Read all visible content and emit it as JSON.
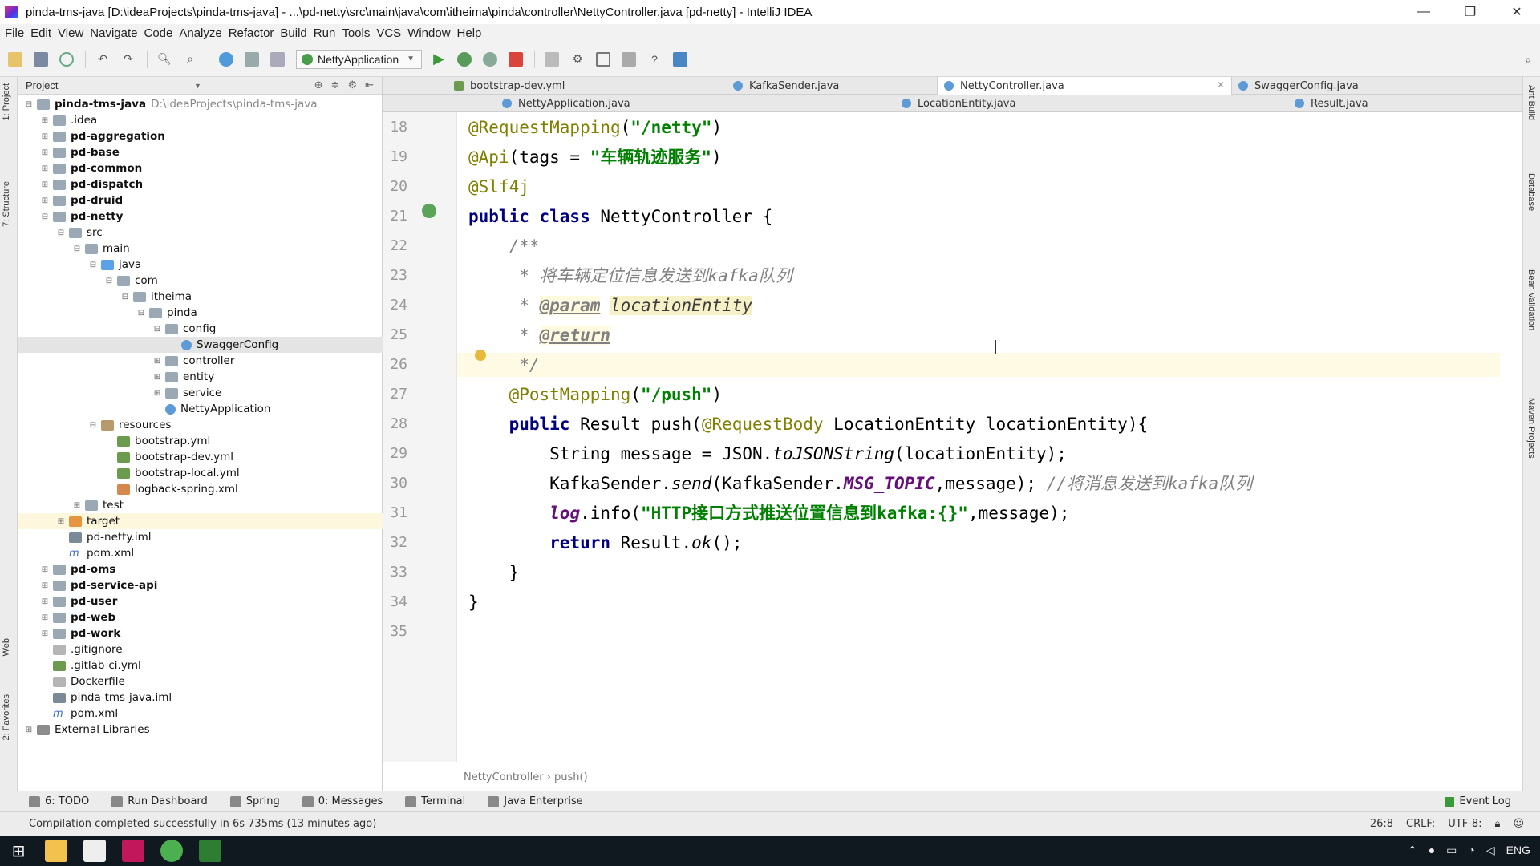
{
  "window": {
    "title": "pinda-tms-java [D:\\ideaProjects\\pinda-tms-java] - ...\\pd-netty\\src\\main\\java\\com\\itheima\\pinda\\controller\\NettyController.java [pd-netty] - IntelliJ IDEA",
    "minimize": "—",
    "restore": "❐",
    "close": "✕"
  },
  "menu": [
    "File",
    "Edit",
    "View",
    "Navigate",
    "Code",
    "Analyze",
    "Refactor",
    "Build",
    "Run",
    "Tools",
    "VCS",
    "Window",
    "Help"
  ],
  "toolbar": {
    "run_config": "NettyApplication",
    "icons": [
      "open-icon",
      "save-icon",
      "sync-icon",
      "undo-icon",
      "redo-icon",
      "find-icon",
      "replace-icon",
      "back-icon",
      "forward-icon",
      "run-icon",
      "debug-icon",
      "coverage-icon",
      "stop-icon",
      "build-icon",
      "settings-icon",
      "structure-icon",
      "help-icon",
      "search-icon"
    ]
  },
  "project_panel": {
    "header": "Project",
    "tree": [
      {
        "label": "pinda-tms-java",
        "extra": "D:\\ideaProjects\\pinda-tms-java",
        "depth": 0,
        "toggle": "⊟",
        "icon": "module",
        "bold": true
      },
      {
        "label": ".idea",
        "depth": 1,
        "toggle": "⊞",
        "icon": "folder"
      },
      {
        "label": "pd-aggregation",
        "depth": 1,
        "toggle": "⊞",
        "icon": "module",
        "bold": true
      },
      {
        "label": "pd-base",
        "depth": 1,
        "toggle": "⊞",
        "icon": "module",
        "bold": true
      },
      {
        "label": "pd-common",
        "depth": 1,
        "toggle": "⊞",
        "icon": "module",
        "bold": true
      },
      {
        "label": "pd-dispatch",
        "depth": 1,
        "toggle": "⊞",
        "icon": "module",
        "bold": true
      },
      {
        "label": "pd-druid",
        "depth": 1,
        "toggle": "⊞",
        "icon": "module",
        "bold": true
      },
      {
        "label": "pd-netty",
        "depth": 1,
        "toggle": "⊟",
        "icon": "module",
        "bold": true
      },
      {
        "label": "src",
        "depth": 2,
        "toggle": "⊟",
        "icon": "folder"
      },
      {
        "label": "main",
        "depth": 3,
        "toggle": "⊟",
        "icon": "folder"
      },
      {
        "label": "java",
        "depth": 4,
        "toggle": "⊟",
        "icon": "src"
      },
      {
        "label": "com",
        "depth": 5,
        "toggle": "⊟",
        "icon": "folder"
      },
      {
        "label": "itheima",
        "depth": 6,
        "toggle": "⊟",
        "icon": "folder"
      },
      {
        "label": "pinda",
        "depth": 7,
        "toggle": "⊟",
        "icon": "folder"
      },
      {
        "label": "config",
        "depth": 8,
        "toggle": "⊟",
        "icon": "folder"
      },
      {
        "label": "SwaggerConfig",
        "depth": 9,
        "toggle": "",
        "icon": "class",
        "selected": true
      },
      {
        "label": "controller",
        "depth": 8,
        "toggle": "⊞",
        "icon": "folder"
      },
      {
        "label": "entity",
        "depth": 8,
        "toggle": "⊞",
        "icon": "folder"
      },
      {
        "label": "service",
        "depth": 8,
        "toggle": "⊞",
        "icon": "folder"
      },
      {
        "label": "NettyApplication",
        "depth": 8,
        "toggle": "",
        "icon": "class"
      },
      {
        "label": "resources",
        "depth": 4,
        "toggle": "⊟",
        "icon": "res"
      },
      {
        "label": "bootstrap.yml",
        "depth": 5,
        "toggle": "",
        "icon": "yml"
      },
      {
        "label": "bootstrap-dev.yml",
        "depth": 5,
        "toggle": "",
        "icon": "yml"
      },
      {
        "label": "bootstrap-local.yml",
        "depth": 5,
        "toggle": "",
        "icon": "yml"
      },
      {
        "label": "logback-spring.xml",
        "depth": 5,
        "toggle": "",
        "icon": "xml"
      },
      {
        "label": "test",
        "depth": 3,
        "toggle": "⊞",
        "icon": "folder"
      },
      {
        "label": "target",
        "depth": 2,
        "toggle": "⊞",
        "icon": "target",
        "target": true
      },
      {
        "label": "pd-netty.iml",
        "depth": 2,
        "toggle": "",
        "icon": "iml"
      },
      {
        "label": "pom.xml",
        "depth": 2,
        "toggle": "",
        "icon": "pom"
      },
      {
        "label": "pd-oms",
        "depth": 1,
        "toggle": "⊞",
        "icon": "module",
        "bold": true
      },
      {
        "label": "pd-service-api",
        "depth": 1,
        "toggle": "⊞",
        "icon": "module",
        "bold": true
      },
      {
        "label": "pd-user",
        "depth": 1,
        "toggle": "⊞",
        "icon": "module",
        "bold": true
      },
      {
        "label": "pd-web",
        "depth": 1,
        "toggle": "⊞",
        "icon": "module",
        "bold": true
      },
      {
        "label": "pd-work",
        "depth": 1,
        "toggle": "⊞",
        "icon": "module",
        "bold": true
      },
      {
        "label": ".gitignore",
        "depth": 1,
        "toggle": "",
        "icon": "file"
      },
      {
        "label": ".gitlab-ci.yml",
        "depth": 1,
        "toggle": "",
        "icon": "yml"
      },
      {
        "label": "Dockerfile",
        "depth": 1,
        "toggle": "",
        "icon": "file"
      },
      {
        "label": "pinda-tms-java.iml",
        "depth": 1,
        "toggle": "",
        "icon": "iml"
      },
      {
        "label": "pom.xml",
        "depth": 1,
        "toggle": "",
        "icon": "pom"
      },
      {
        "label": "External Libraries",
        "depth": 0,
        "toggle": "⊞",
        "icon": "lib"
      }
    ]
  },
  "tabs_row1": [
    {
      "label": "bootstrap-dev.yml",
      "icon": "yml"
    },
    {
      "label": "KafkaSender.java",
      "icon": "class"
    },
    {
      "label": "NettyController.java",
      "icon": "class",
      "active": true,
      "close": "✕"
    },
    {
      "label": "SwaggerConfig.java",
      "icon": "class"
    }
  ],
  "tabs_row2": [
    {
      "label": "NettyApplication.java",
      "icon": "class"
    },
    {
      "label": "LocationEntity.java",
      "icon": "class"
    },
    {
      "label": "Result.java",
      "icon": "class"
    }
  ],
  "editor": {
    "lines": [
      {
        "no": "18",
        "html": "<span class=\"ann\">@RequestMapping</span>(<span class=\"str\">\"/netty\"</span>)"
      },
      {
        "no": "19",
        "html": "<span class=\"ann\">@Api</span>(tags = <span class=\"str\">\"车辆轨迹服务\"</span>)"
      },
      {
        "no": "20",
        "html": "<span class=\"ann\">@Slf4j</span>"
      },
      {
        "no": "21",
        "html": "<span class=\"kw\">public class</span> NettyController {"
      },
      {
        "no": "22",
        "html": "    <span class=\"com\">/**</span>"
      },
      {
        "no": "23",
        "html": "<span class=\"com\">     * 将车辆定位信息发送到kafka队列</span>"
      },
      {
        "no": "24",
        "html": "<span class=\"com\">     * </span><span class=\"tag\">@param</span> <span class=\"param-hl\">locationEntity</span>"
      },
      {
        "no": "25",
        "html": "<span class=\"com\">     * </span><span class=\"tag\">@return</span>"
      },
      {
        "no": "26",
        "html": "<span class=\"com\">     */</span>",
        "current": true
      },
      {
        "no": "27",
        "html": "    <span class=\"ann\">@PostMapping</span>(<span class=\"str\">\"/push\"</span>)"
      },
      {
        "no": "28",
        "html": "    <span class=\"kw\">public</span> Result push(<span class=\"ann\">@RequestBody</span> LocationEntity locationEntity){"
      },
      {
        "no": "29",
        "html": "        String message = JSON.<span class=\"static-call\">toJSONString</span>(locationEntity);"
      },
      {
        "no": "30",
        "html": "        KafkaSender.<span class=\"static-call\">send</span>(KafkaSender.<span class=\"static-field\">MSG_TOPIC</span>,message); <span class=\"com\">//将消息发送到kafka队列</span>"
      },
      {
        "no": "31",
        "html": "        <span class=\"logf\">log</span>.info(<span class=\"str\">\"HTTP接口方式推送位置信息到kafka:{}\"</span>,message);"
      },
      {
        "no": "32",
        "html": "        <span class=\"kw\">return</span> Result.<span class=\"static-call\">ok</span>();"
      },
      {
        "no": "33",
        "html": "    }"
      },
      {
        "no": "34",
        "html": "}"
      },
      {
        "no": "35",
        "html": ""
      }
    ],
    "breadcrumb": "NettyController › push()"
  },
  "left_strip": [
    "1: Project",
    "7: Structure",
    "Web",
    "2: Favorites"
  ],
  "right_strip": [
    "Ant Build",
    "Database",
    "Bean Validation",
    "Maven Projects"
  ],
  "bottom_tools": [
    "6: TODO",
    "Run Dashboard",
    "Spring",
    "0: Messages",
    "Terminal",
    "Java Enterprise"
  ],
  "event_log": "Event Log",
  "status": {
    "message": "Compilation completed successfully in 6s 735ms (13 minutes ago)",
    "position": "26:8",
    "line_sep": "CRLF:",
    "encoding": "UTF-8:"
  },
  "taskbar": {
    "tray_lang": "ENG"
  },
  "colors": {
    "annotation": "#808000",
    "keyword": "#000080",
    "string": "#008000",
    "comment": "#808080",
    "current_line": "#fffae3"
  }
}
